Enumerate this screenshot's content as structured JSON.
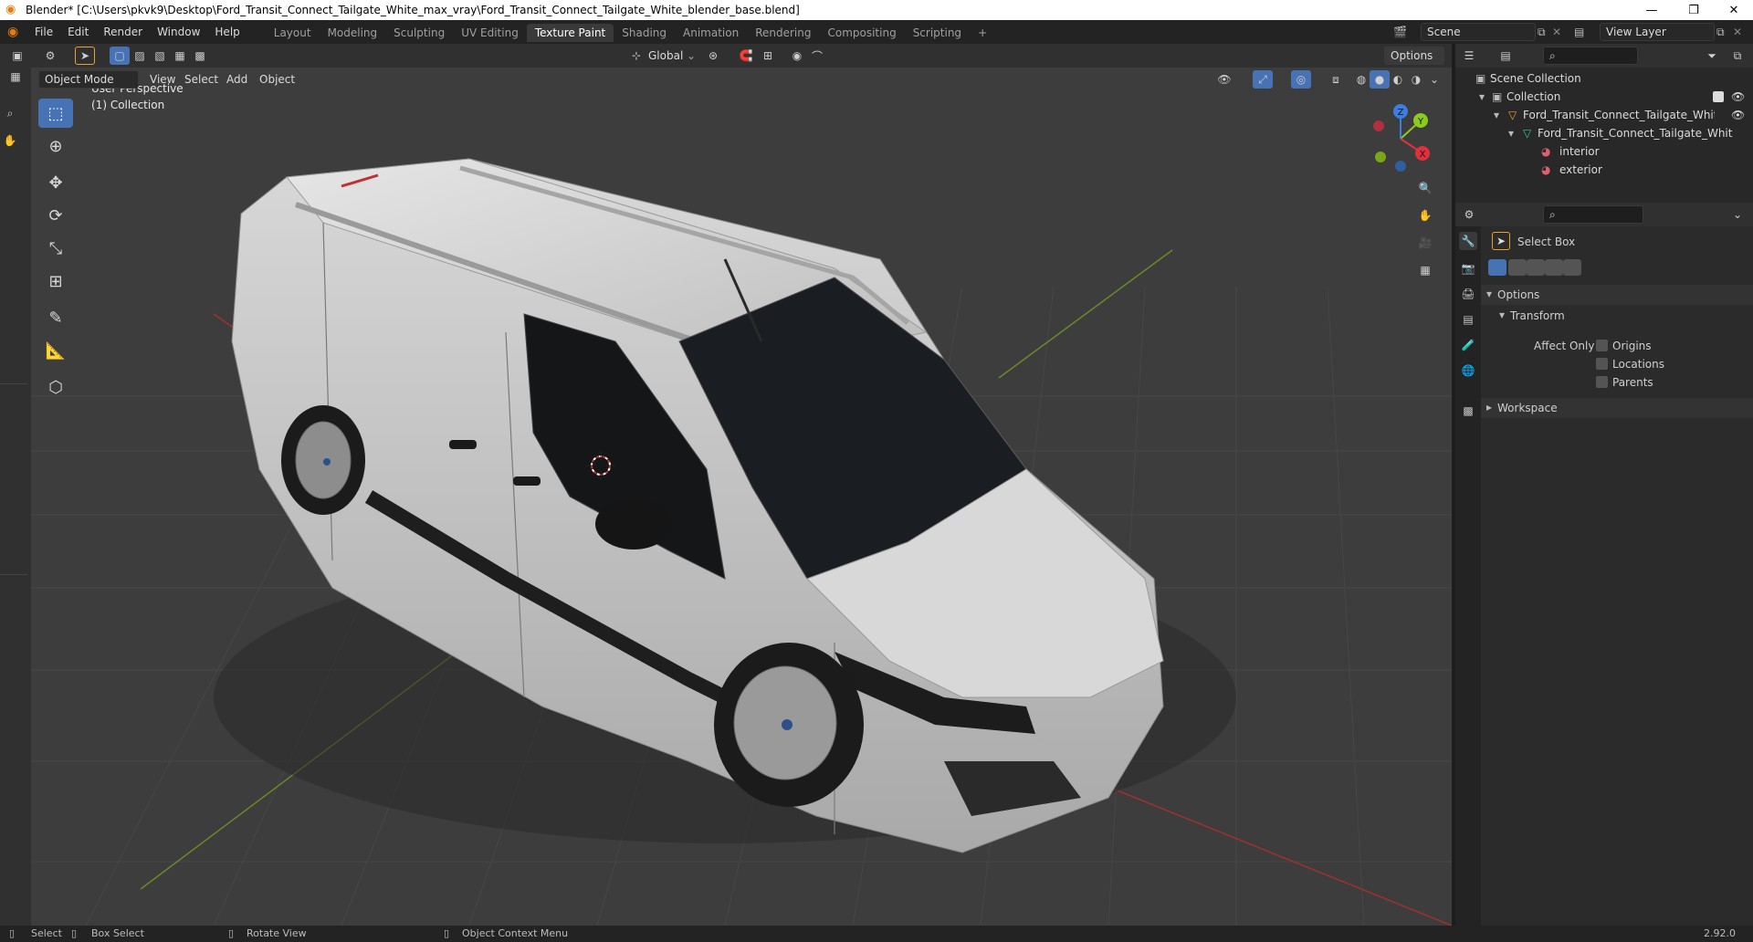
{
  "window": {
    "title": "Blender* [C:\\Users\\pkvk9\\Desktop\\Ford_Transit_Connect_Tailgate_White_max_vray\\Ford_Transit_Connect_Tailgate_White_blender_base.blend]",
    "minimize": "—",
    "maximize": "❐",
    "close": "✕"
  },
  "menu": [
    "File",
    "Edit",
    "Render",
    "Window",
    "Help"
  ],
  "workspaces": {
    "tabs": [
      "Layout",
      "Modeling",
      "Sculpting",
      "UV Editing",
      "Texture Paint",
      "Shading",
      "Animation",
      "Rendering",
      "Compositing",
      "Scripting"
    ],
    "active": "Texture Paint",
    "add": "+"
  },
  "scene": {
    "label": "Scene",
    "view_layer": "View Layer"
  },
  "tool_header": {
    "orientation": "Global",
    "options": "Options"
  },
  "viewport_header": {
    "mode": "Object Mode",
    "menus": [
      "View",
      "Select",
      "Add",
      "Object"
    ]
  },
  "viewport": {
    "perspective": "User Perspective",
    "collection": "(1) Collection",
    "gizmo": {
      "x": "X",
      "y": "Y",
      "z": "Z"
    }
  },
  "outliner": {
    "root": "Scene Collection",
    "collection": "Collection",
    "object": "Ford_Transit_Connect_Tailgate_White_ol",
    "mesh": "Ford_Transit_Connect_Tailgate_Whit",
    "materials": [
      "interior",
      "exterior"
    ]
  },
  "properties": {
    "tool_name": "Select Box",
    "options_label": "Options",
    "transform_label": "Transform",
    "affect_only": "Affect Only",
    "checkboxes": [
      "Origins",
      "Locations",
      "Parents"
    ],
    "workspace_label": "Workspace"
  },
  "statusbar": {
    "select": "Select",
    "box_select": "Box Select",
    "rotate": "Rotate View",
    "context": "Object Context Menu",
    "version": "2.92.0"
  },
  "colors": {
    "accent": "#4772b3",
    "active_tab": "#3a3a3a",
    "axis_x": "#e0303c",
    "axis_y": "#8ccc1a",
    "axis_z": "#3c7ee0"
  }
}
